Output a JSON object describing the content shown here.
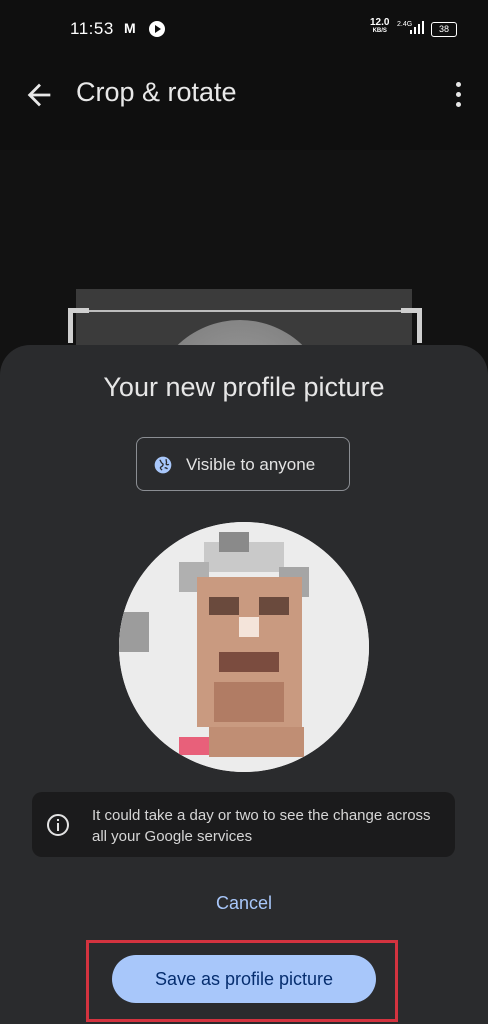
{
  "status_bar": {
    "time": "11:53",
    "notification_icons": [
      "gmail-icon",
      "play-icon"
    ],
    "network_speed": "12.0",
    "network_speed_unit": "KB/S",
    "network_type": "2.4G",
    "battery": "38"
  },
  "app_bar": {
    "title": "Crop & rotate"
  },
  "sheet": {
    "title": "Your new profile picture",
    "visibility_label": "Visible to anyone",
    "info_text": "It could take a day or two to see the change across all your Google services",
    "cancel_label": "Cancel",
    "save_label": "Save as profile picture"
  },
  "colors": {
    "accent": "#a8c7fa",
    "sheet_bg": "#2a2b2d",
    "highlight": "#d3333f"
  }
}
